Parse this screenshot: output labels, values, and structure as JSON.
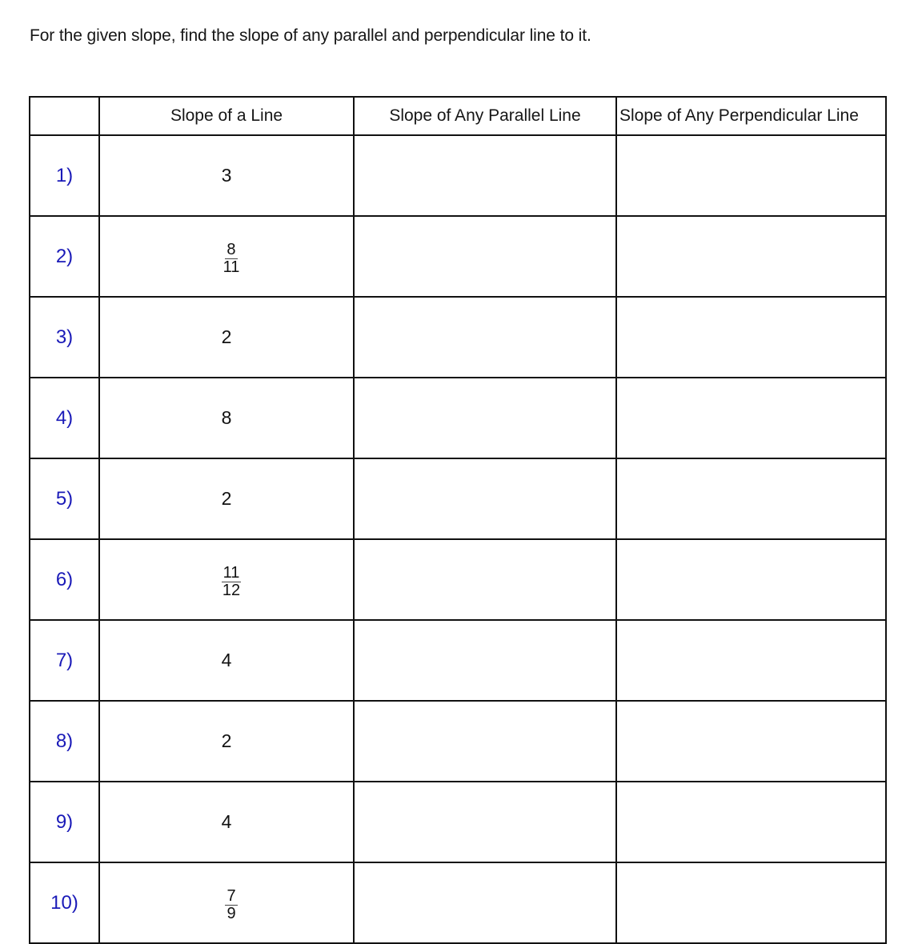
{
  "instructions": "For the given slope, find the slope of any parallel and perpendicular line to it.",
  "table": {
    "headers": {
      "number": "",
      "slope": "Slope of a Line",
      "parallel": "Slope of Any Parallel Line",
      "perpendicular": "Slope of Any Perpendicular Line"
    },
    "rows": [
      {
        "label": "1)",
        "slope": {
          "type": "integer",
          "value": "3"
        },
        "parallel": "",
        "perpendicular": ""
      },
      {
        "label": "2)",
        "slope": {
          "type": "fraction",
          "numerator": "8",
          "denominator": "11"
        },
        "parallel": "",
        "perpendicular": ""
      },
      {
        "label": "3)",
        "slope": {
          "type": "integer",
          "value": "2"
        },
        "parallel": "",
        "perpendicular": ""
      },
      {
        "label": "4)",
        "slope": {
          "type": "integer",
          "value": "8"
        },
        "parallel": "",
        "perpendicular": ""
      },
      {
        "label": "5)",
        "slope": {
          "type": "integer",
          "value": "2"
        },
        "parallel": "",
        "perpendicular": ""
      },
      {
        "label": "6)",
        "slope": {
          "type": "fraction",
          "numerator": "11",
          "denominator": "12"
        },
        "parallel": "",
        "perpendicular": ""
      },
      {
        "label": "7)",
        "slope": {
          "type": "integer",
          "value": "4"
        },
        "parallel": "",
        "perpendicular": ""
      },
      {
        "label": "8)",
        "slope": {
          "type": "integer",
          "value": "2"
        },
        "parallel": "",
        "perpendicular": ""
      },
      {
        "label": "9)",
        "slope": {
          "type": "integer",
          "value": "4"
        },
        "parallel": "",
        "perpendicular": ""
      },
      {
        "label": "10)",
        "slope": {
          "type": "fraction",
          "numerator": "7",
          "denominator": "9"
        },
        "parallel": "",
        "perpendicular": ""
      }
    ]
  },
  "colors": {
    "problem_number": "#1a1ab8",
    "text": "#111111",
    "border": "#111111"
  }
}
